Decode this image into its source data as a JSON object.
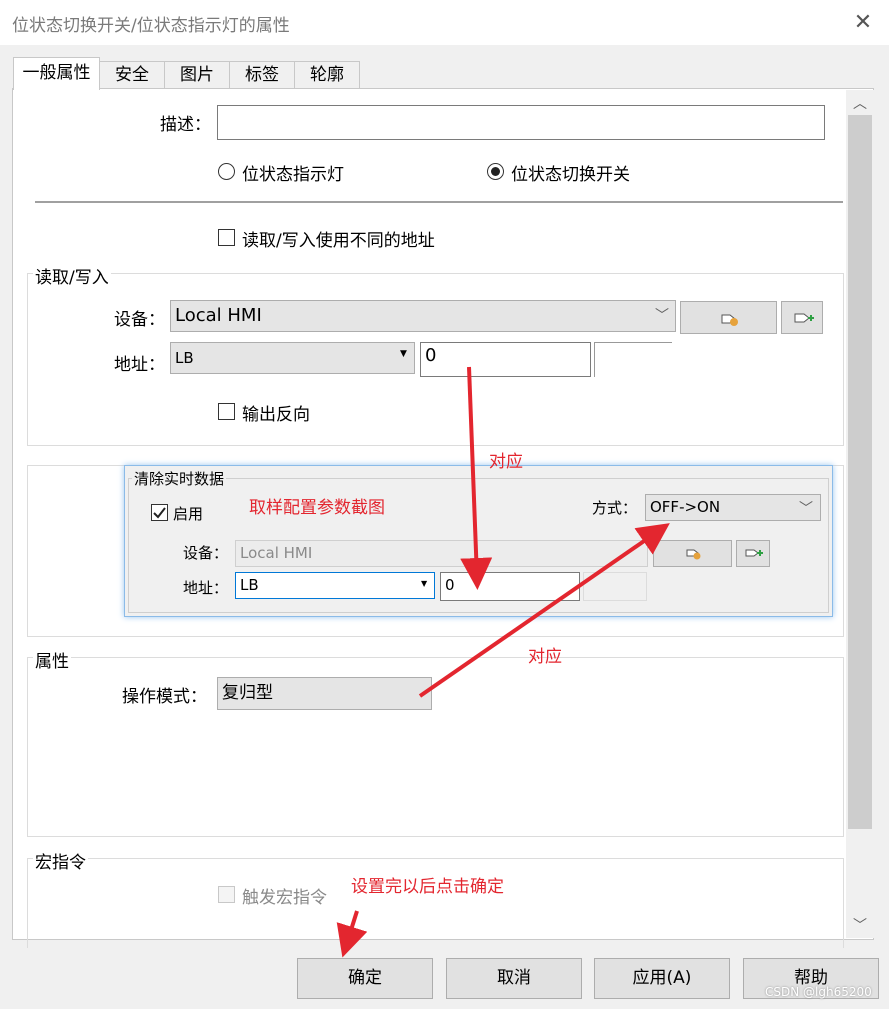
{
  "window": {
    "title": "位状态切换开关/位状态指示灯的属性"
  },
  "tabs": [
    "一般属性",
    "安全",
    "图片",
    "标签",
    "轮廓"
  ],
  "general": {
    "desc_label": "描述：",
    "desc_value": "",
    "radio_lamp": "位状态指示灯",
    "radio_switch": "位状态切换开关",
    "diff_addr_label": "读取/写入使用不同的地址"
  },
  "rw": {
    "legend": "读取/写入",
    "device_label": "设备：",
    "device_value": "Local HMI",
    "address_label": "地址：",
    "addr_type": "LB",
    "addr_value": "0",
    "invert_label": "输出反向"
  },
  "clear": {
    "legend": "清除实时数据",
    "enable_label": "启用",
    "mode_label": "方式：",
    "mode_value": "OFF->ON",
    "device_label": "设备：",
    "device_value": "Local HMI",
    "address_label": "地址：",
    "addr_type": "LB",
    "addr_value": "0"
  },
  "attr": {
    "legend": "属性",
    "op_mode_label": "操作模式：",
    "op_mode_value": "复归型"
  },
  "macro": {
    "legend": "宏指令",
    "trigger_label": "触发宏指令"
  },
  "annotations": {
    "sample": "取样配置参数截图",
    "corresponds1": "对应",
    "corresponds2": "对应",
    "confirm_hint": "设置完以后点击确定"
  },
  "footer": {
    "ok": "确定",
    "cancel": "取消",
    "apply": "应用(A)",
    "help": "帮助"
  },
  "watermark": "CSDN @lgh65200",
  "colors": {
    "annotation_red": "#e3262f",
    "focus_blue": "#0078d7"
  }
}
